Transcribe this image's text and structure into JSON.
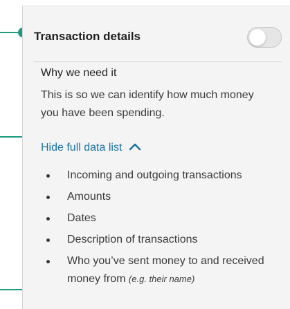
{
  "colors": {
    "accent": "#1a9a7f",
    "link": "#1a73a8",
    "card_background": "#f4f4f4"
  },
  "section": {
    "title": "Transaction details",
    "toggle_state": "off"
  },
  "why": {
    "title": "Why we need it",
    "body": "This is so we can identify how much money you have been spending."
  },
  "hide_link": {
    "label": "Hide full data list",
    "icon": "chevron-up-icon"
  },
  "data_list": {
    "items": [
      {
        "text": "Incoming and outgoing transactions"
      },
      {
        "text": "Amounts"
      },
      {
        "text": "Dates"
      },
      {
        "text": "Description of transactions"
      },
      {
        "text": "Who you’ve sent money to and received money from ",
        "example": "(e.g. their name)"
      }
    ]
  }
}
